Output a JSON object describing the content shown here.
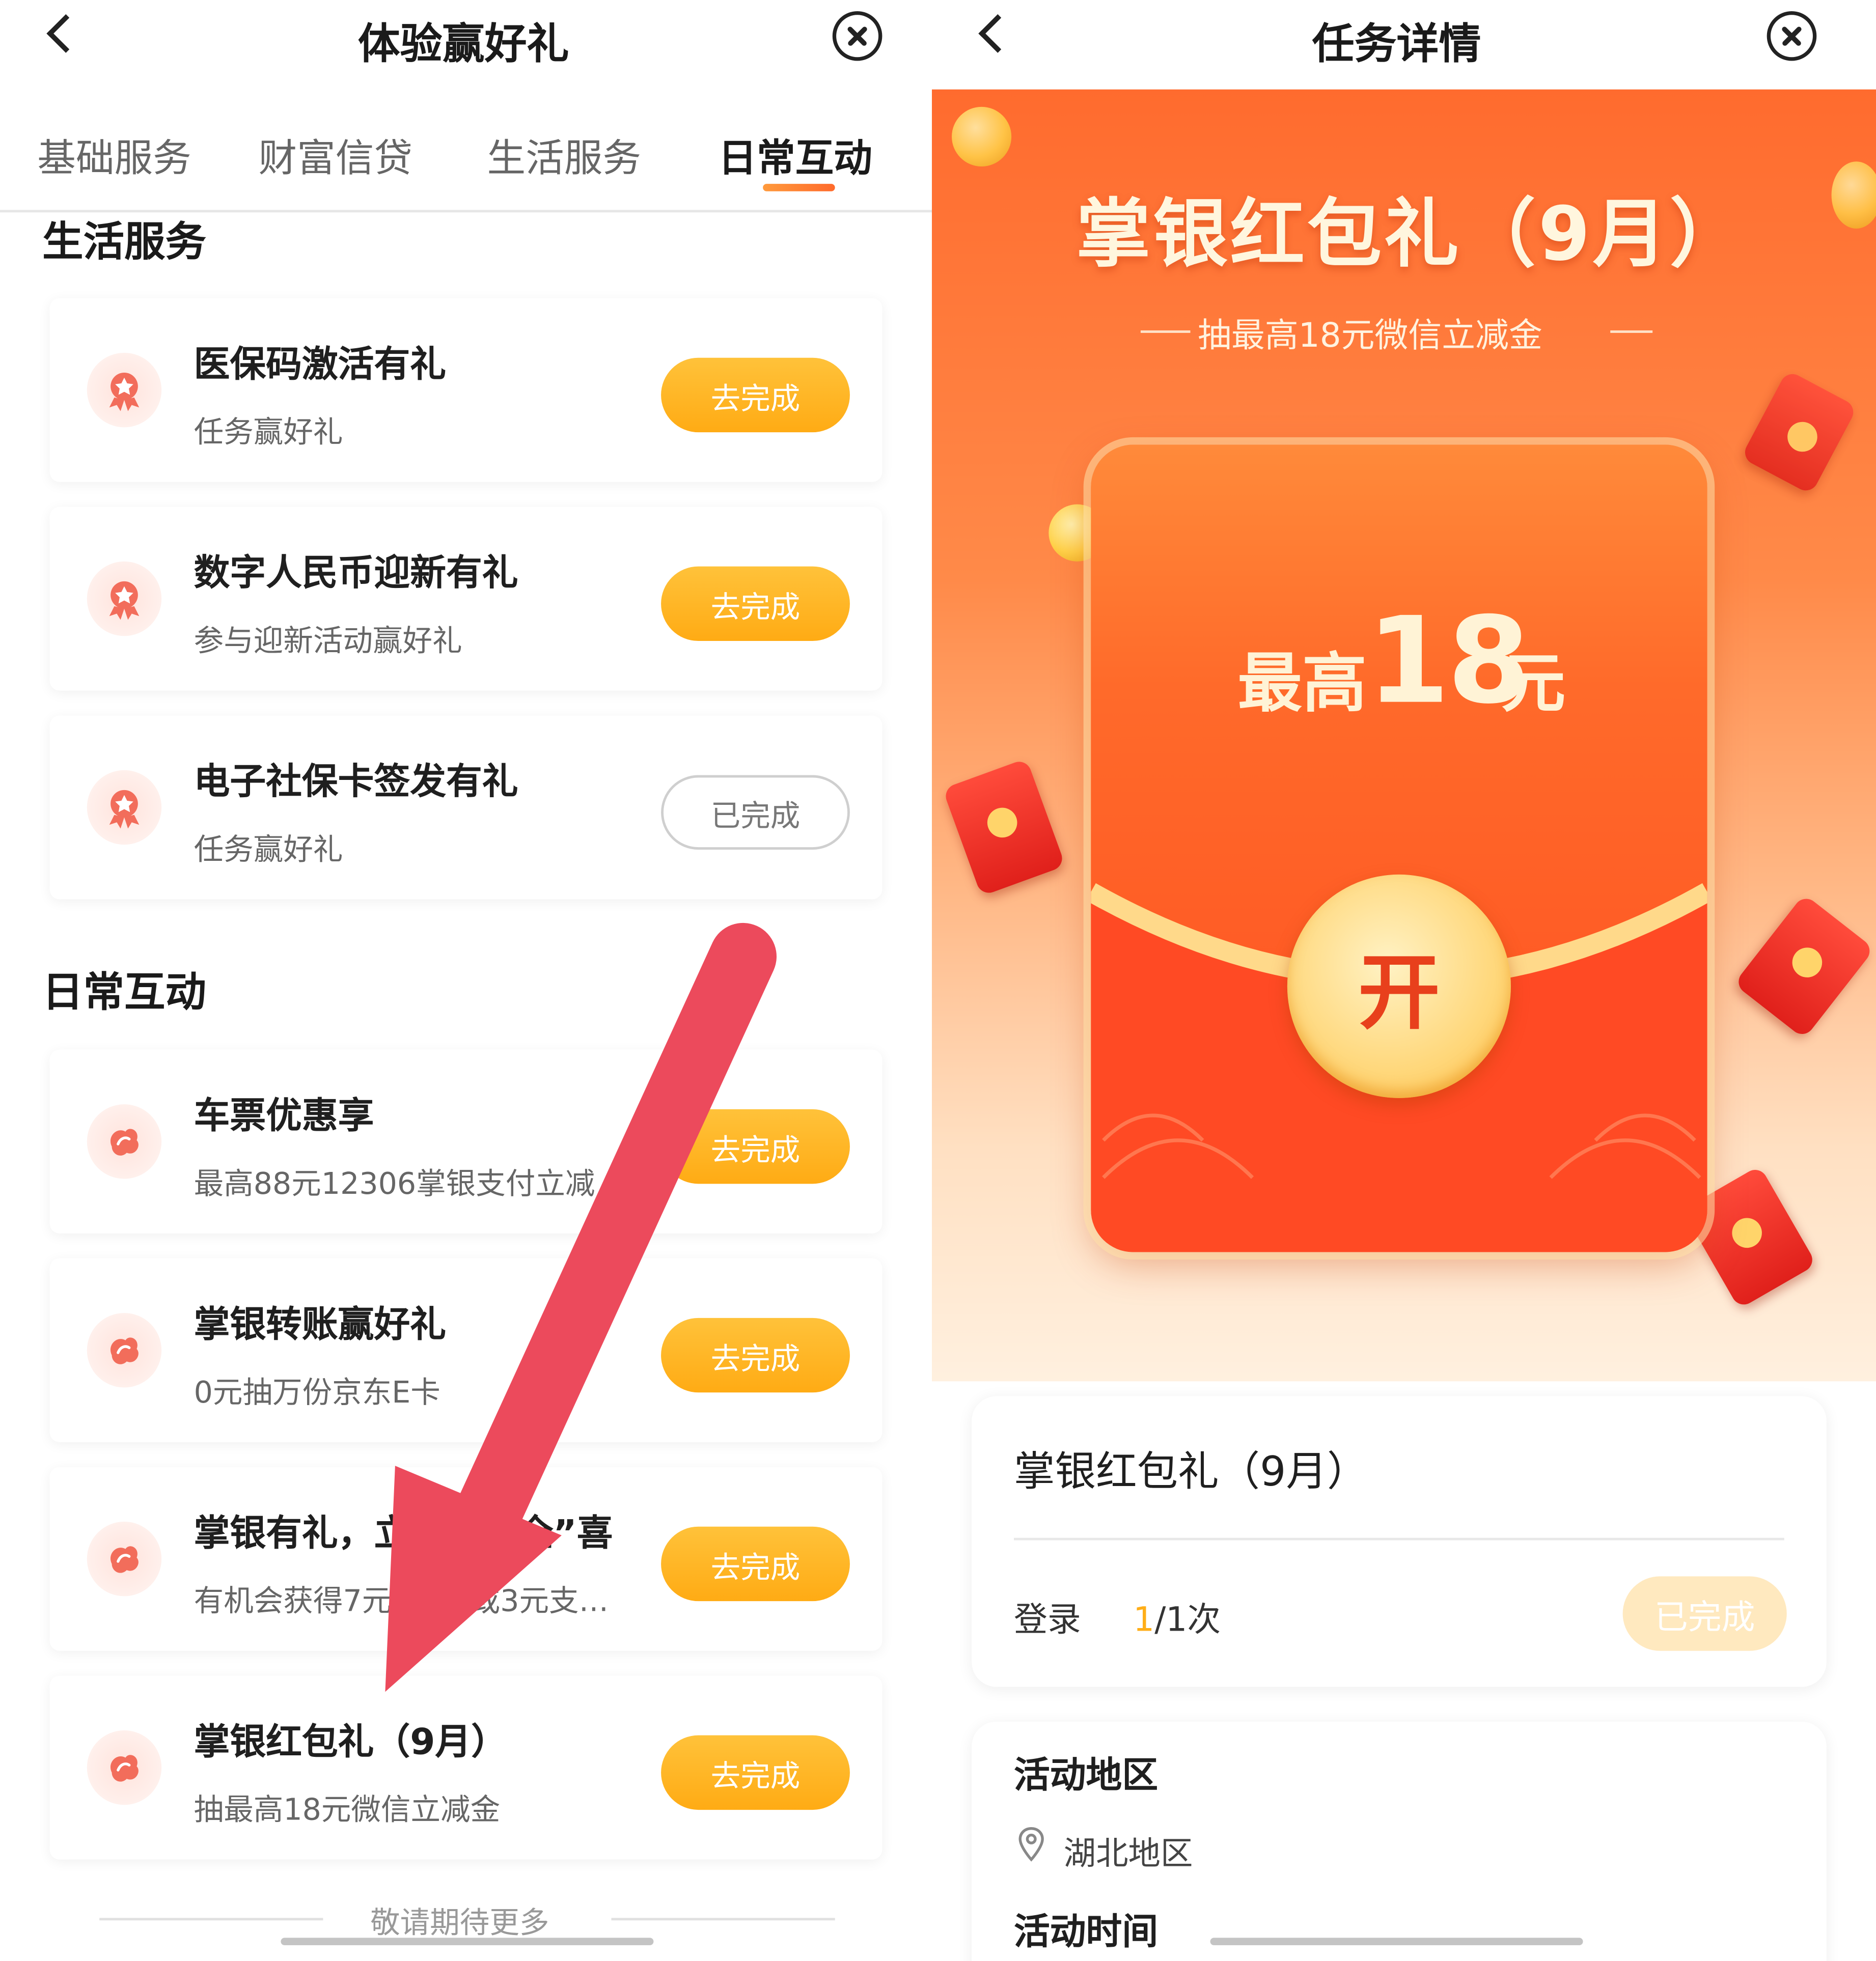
{
  "left": {
    "nav_title": "体验赢好礼",
    "tabs": [
      {
        "label": "基础服务"
      },
      {
        "label": "财富信贷"
      },
      {
        "label": "生活服务"
      },
      {
        "label": "日常互动"
      }
    ],
    "sections": [
      {
        "title": "生活服务",
        "items": [
          {
            "title": "医保码激活有礼",
            "subtitle": "任务赢好礼",
            "action": "去完成"
          },
          {
            "title": "数字人民币迎新有礼",
            "subtitle": "参与迎新活动赢好礼",
            "action": "去完成"
          },
          {
            "title": "电子社保卡签发有礼",
            "subtitle": "任务赢好礼",
            "action": "已完成"
          }
        ]
      },
      {
        "title": "日常互动",
        "items": [
          {
            "title": "车票优惠享",
            "subtitle": "最高88元12306掌银支付立减",
            "action": "去完成"
          },
          {
            "title": "掌银转账赢好礼",
            "subtitle": "0元抽万份京东E卡",
            "action": "去完成"
          },
          {
            "title": "掌银有礼，立“享”“全”喜",
            "subtitle": "有机会获得7元、5元或3元支…",
            "action": "去完成"
          },
          {
            "title": "掌银红包礼（9月）",
            "subtitle": "抽最高18元微信立减金",
            "action": "去完成"
          }
        ]
      }
    ],
    "footer_text": "敬请期待更多"
  },
  "right": {
    "nav_title": "任务详情",
    "hero": {
      "title": "掌银红包礼（9月）",
      "subtitle": "抽最高18元微信立减金",
      "amount_prefix": "最高",
      "amount_value": "18",
      "amount_unit": "元",
      "open_label": "开"
    },
    "task_card": {
      "title": "掌银红包礼（9月）",
      "task_label": "登录",
      "count_current": "1",
      "count_rest": "/1次",
      "status": "已完成"
    },
    "info": {
      "region_title": "活动地区",
      "region_value": "湖北地区",
      "time_title": "活动时间"
    }
  },
  "colors": {
    "accent_orange": "#ffab14",
    "hero_red": "#ff4d20",
    "annotation_arrow": "#ec4a5c"
  },
  "icons": {
    "back": "chevron-left-icon",
    "close": "close-circle-icon",
    "badge": "medal-badge-icon",
    "ticket": "coupon-icon",
    "location": "location-pin-icon"
  }
}
